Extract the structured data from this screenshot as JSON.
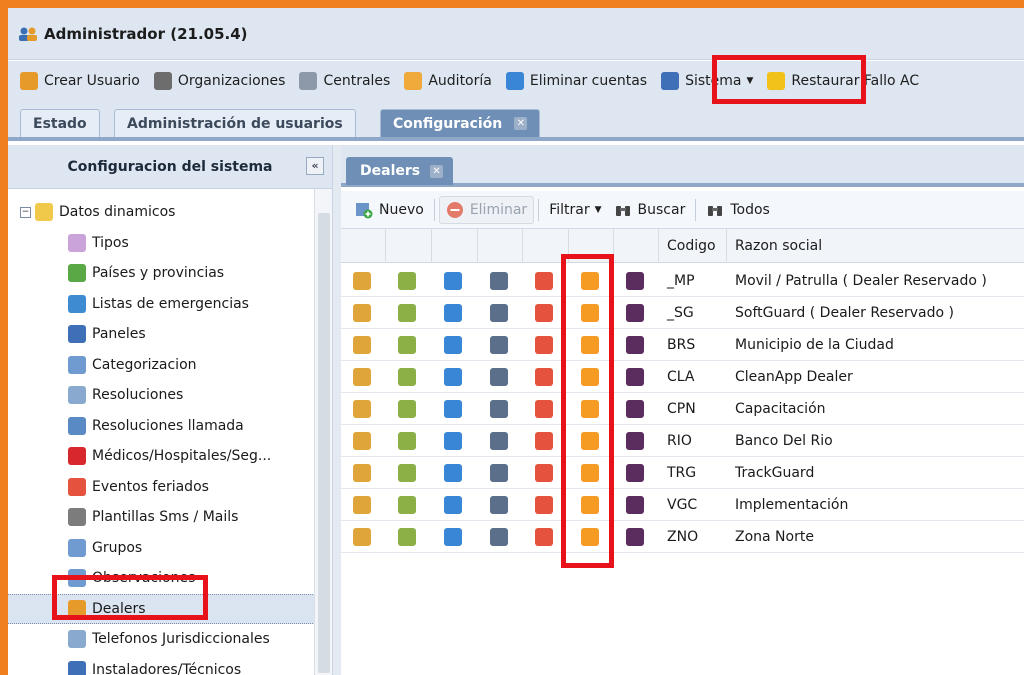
{
  "window": {
    "title": "Administrador (21.05.4)"
  },
  "toolbar": [
    {
      "label": "Crear Usuario",
      "icon": "users-add-icon",
      "color": "#e59a2a"
    },
    {
      "label": "Organizaciones",
      "icon": "organization-icon",
      "color": "#6d6d6d"
    },
    {
      "label": "Centrales",
      "icon": "building-icon",
      "color": "#8d98a8"
    },
    {
      "label": "Auditoría",
      "icon": "audit-icon",
      "color": "#f0a93b"
    },
    {
      "label": "Eliminar cuentas",
      "icon": "delete-accounts-icon",
      "color": "#3a86d6"
    },
    {
      "label": "Sistema",
      "icon": "monitor-icon",
      "color": "#3f6fb7",
      "dropdown": true
    },
    {
      "label": "Restaurar Fallo AC",
      "icon": "warning-icon",
      "color": "#f2c21b"
    }
  ],
  "tabs": [
    {
      "label": "Estado",
      "active": false
    },
    {
      "label": "Administración de usuarios",
      "active": false
    },
    {
      "label": "Configuración",
      "active": true,
      "closable": true
    }
  ],
  "left_panel": {
    "title": "Configuracion del sistema",
    "collapse_glyph": "«",
    "tree": [
      {
        "label": "Datos dinamicos",
        "icon": "folder-icon",
        "color": "#f1c94a",
        "expander": "−"
      },
      {
        "label": "Tipos",
        "icon": "tag-icon",
        "color": "#c9a3d9"
      },
      {
        "label": "Países y provincias",
        "icon": "globe-icon",
        "color": "#58a845"
      },
      {
        "label": "Listas de emergencias",
        "icon": "list-icon",
        "color": "#3f8bd2"
      },
      {
        "label": "Paneles",
        "icon": "panel-icon",
        "color": "#3f6fb7"
      },
      {
        "label": "Categorizacion",
        "icon": "table-icon",
        "color": "#6f9bd1"
      },
      {
        "label": "Resoluciones",
        "icon": "grid-icon",
        "color": "#8aa9cf"
      },
      {
        "label": "Resoluciones llamada",
        "icon": "call-resolution-icon",
        "color": "#5a8ac4"
      },
      {
        "label": "Médicos/Hospitales/Seg...",
        "icon": "medical-icon",
        "color": "#d8272d"
      },
      {
        "label": "Eventos feriados",
        "icon": "calendar-icon",
        "color": "#e5523e"
      },
      {
        "label": "Plantillas Sms / Mails",
        "icon": "template-icon",
        "color": "#7c7c7c"
      },
      {
        "label": "Grupos",
        "icon": "groups-icon",
        "color": "#6f9bd1"
      },
      {
        "label": "Observaciones",
        "icon": "comment-icon",
        "color": "#6f9bd1"
      },
      {
        "label": "Dealers",
        "icon": "dealers-icon",
        "color": "#e59a2a",
        "selected": true
      },
      {
        "label": "Telefonos Jurisdiccionales",
        "icon": "phone-list-icon",
        "color": "#8aa9cf"
      },
      {
        "label": "Instaladores/Técnicos",
        "icon": "technician-icon",
        "color": "#3f6fb7"
      }
    ]
  },
  "content": {
    "tab": {
      "label": "Dealers"
    },
    "grid_toolbar": {
      "new_label": "Nuevo",
      "delete_label": "Eliminar",
      "filter_label": "Filtrar",
      "search_label": "Buscar",
      "all_label": "Todos"
    },
    "columns": {
      "code": "Codigo",
      "name": "Razon social"
    },
    "action_icons": [
      {
        "name": "edit-icon",
        "color": "#e0a53a"
      },
      {
        "name": "device-icon",
        "color": "#8db046"
      },
      {
        "name": "user-icon",
        "color": "#3a86d6"
      },
      {
        "name": "network-icon",
        "color": "#5b6e8a"
      },
      {
        "name": "alert-icon",
        "color": "#e5523e"
      },
      {
        "name": "dealer-user-icon",
        "color": "#f59a23"
      },
      {
        "name": "target-icon",
        "color": "#5a2d5e"
      }
    ],
    "rows": [
      {
        "code": "_MP",
        "name": "Movil / Patrulla ( Dealer Reservado )"
      },
      {
        "code": "_SG",
        "name": "SoftGuard ( Dealer Reservado )"
      },
      {
        "code": "BRS",
        "name": "Municipio de la Ciudad"
      },
      {
        "code": "CLA",
        "name": "CleanApp Dealer"
      },
      {
        "code": "CPN",
        "name": "Capacitación"
      },
      {
        "code": "RIO",
        "name": "Banco Del Rio"
      },
      {
        "code": "TRG",
        "name": "TrackGuard"
      },
      {
        "code": "VGC",
        "name": "Implementación"
      },
      {
        "code": "ZNO",
        "name": "Zona Norte"
      }
    ]
  },
  "colors": {
    "highlight": "#e8121b",
    "frame": "#f07f1e",
    "active_tab": "#6f8fb6"
  }
}
